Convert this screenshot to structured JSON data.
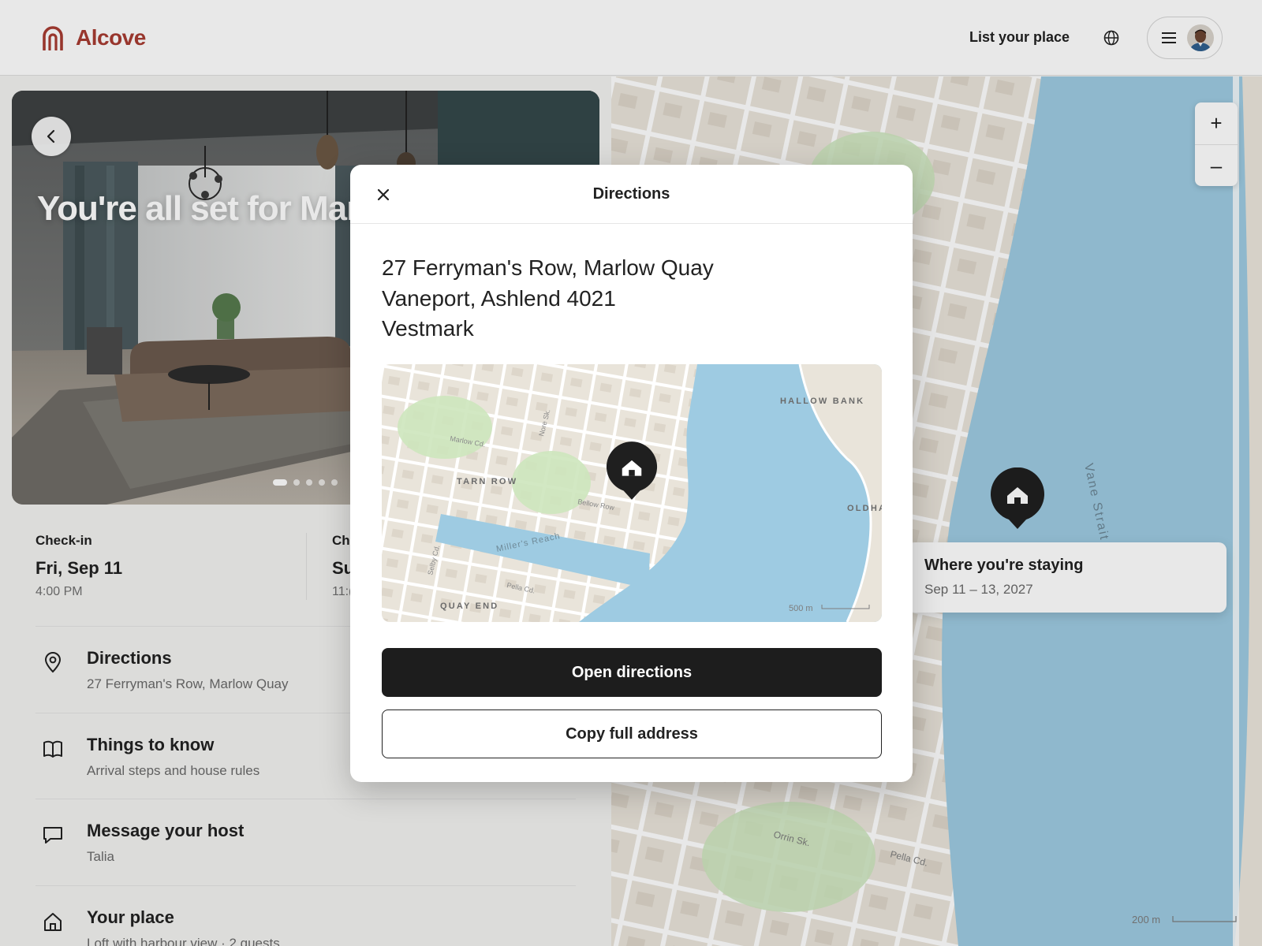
{
  "colors": {
    "brand": "#a83c32",
    "water": "#9ecbe2",
    "land": "#e9e4da",
    "park": "#cde6bd",
    "road": "#ffffff",
    "primary_button": "#1d1d1d"
  },
  "header": {
    "brand_name": "Alcove",
    "brand_icon": "arch-logo-icon",
    "list_place_label": "List your place",
    "globe_icon": "globe-icon",
    "menu_icon": "hamburger-menu-icon"
  },
  "hero": {
    "title": "You're all set for Marlow",
    "back_icon": "chevron-left-icon",
    "photo_count": 5,
    "active_photo": 1
  },
  "stay": {
    "checkin_label": "Check-in",
    "checkin_date": "Fri, Sep 11",
    "checkin_time": "4:00 PM",
    "checkout_label": "Ch",
    "checkout_date": "Su",
    "checkout_time": "11:("
  },
  "rows": [
    {
      "icon": "location-pin-icon",
      "title": "Directions",
      "subtitle": "27 Ferryman's Row, Marlow Quay"
    },
    {
      "icon": "book-icon",
      "title": "Things to know",
      "subtitle": "Arrival steps and house rules"
    },
    {
      "icon": "chat-bubble-icon",
      "title": "Message your host",
      "subtitle": "Talia"
    },
    {
      "icon": "house-icon",
      "title": "Your place",
      "subtitle": "Loft with harbour view · 2 quests"
    }
  ],
  "big_map": {
    "zoom_in": "+",
    "zoom_out": "–",
    "strait_label": "Vane Strait",
    "street_labels": [
      "Orrin Sk.",
      "Pella Cd."
    ],
    "scale_label": "200 m",
    "stay_title": "Where you're staying",
    "stay_dates": "Sep 11 – 13, 2027"
  },
  "modal": {
    "title": "Directions",
    "close_icon": "close-icon",
    "address_lines": [
      "27 Ferryman's Row, Marlow Quay",
      "Vaneport, Ashlend 4021",
      "Vestmark"
    ],
    "map": {
      "labels": [
        "HALLOW BANK",
        "TARN ROW",
        "OLDHA",
        "QUAY END"
      ],
      "street_labels": [
        "Marlow Cd.",
        "Nore Sk.",
        "Bellow Row",
        "Miller's Reach",
        "Selby Cd.",
        "Pella Cd."
      ],
      "scale_label": "500 m"
    },
    "primary_label": "Open directions",
    "secondary_label": "Copy full address"
  }
}
